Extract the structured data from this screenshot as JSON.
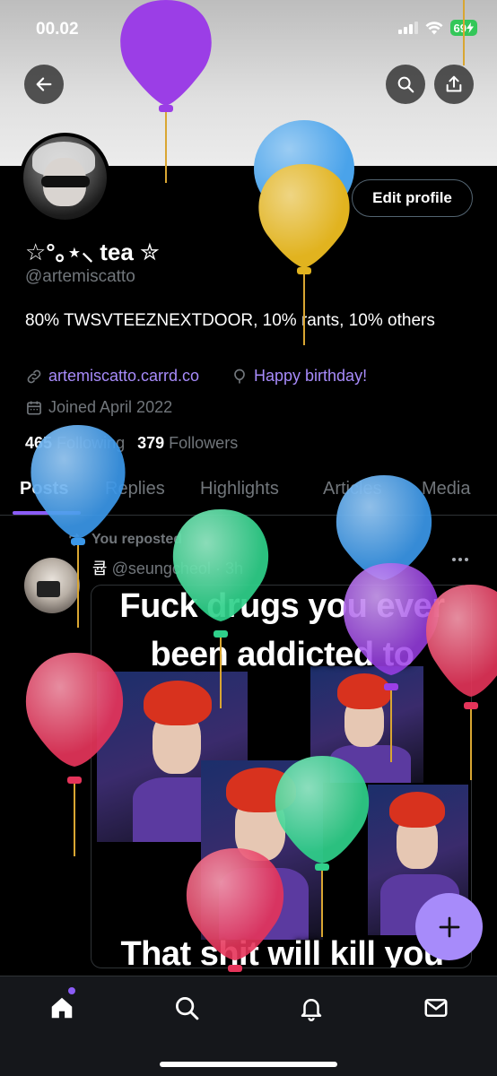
{
  "status_bar": {
    "time": "00.02",
    "battery": "69"
  },
  "header": {
    "back": "back",
    "search": "search",
    "share": "share"
  },
  "profile": {
    "name": "☆°｡⋆⸜ tea ✮",
    "handle": "@artemiscatto",
    "bio": "80% TWSVTEEZNEXTDOOR, 10% rants, 10% others",
    "website": "artemiscatto.carrd.co",
    "birthday": "Happy birthday!",
    "joined": "Joined April 2022",
    "following_count": "465",
    "following_label": "Following",
    "followers_count": "379",
    "followers_label": "Followers",
    "edit_label": "Edit profile"
  },
  "tabs": [
    {
      "label": "Posts",
      "active": true
    },
    {
      "label": "Replies",
      "active": false
    },
    {
      "label": "Highlights",
      "active": false
    },
    {
      "label": "Articles",
      "active": false
    },
    {
      "label": "Media",
      "active": false
    }
  ],
  "post": {
    "repost_label": "You reposted",
    "author": "큡",
    "author_handle": "@seungcheol",
    "time": "· 3h",
    "meme_top_1": "Fuck drugs you ever",
    "meme_top_2": "been addicted to",
    "meme_bottom": "That shit will kill you"
  },
  "colors": {
    "accent": "#8b5cf6",
    "link": "#a78bfa"
  },
  "icons": {
    "back": "arrow-left-icon",
    "search": "search-icon",
    "share": "share-icon",
    "link": "link-icon",
    "birthday": "balloon-icon",
    "calendar": "calendar-icon",
    "repost": "repost-icon",
    "compose": "plus-icon",
    "nav": [
      "home-icon",
      "search-icon",
      "bell-icon",
      "mail-icon"
    ]
  }
}
